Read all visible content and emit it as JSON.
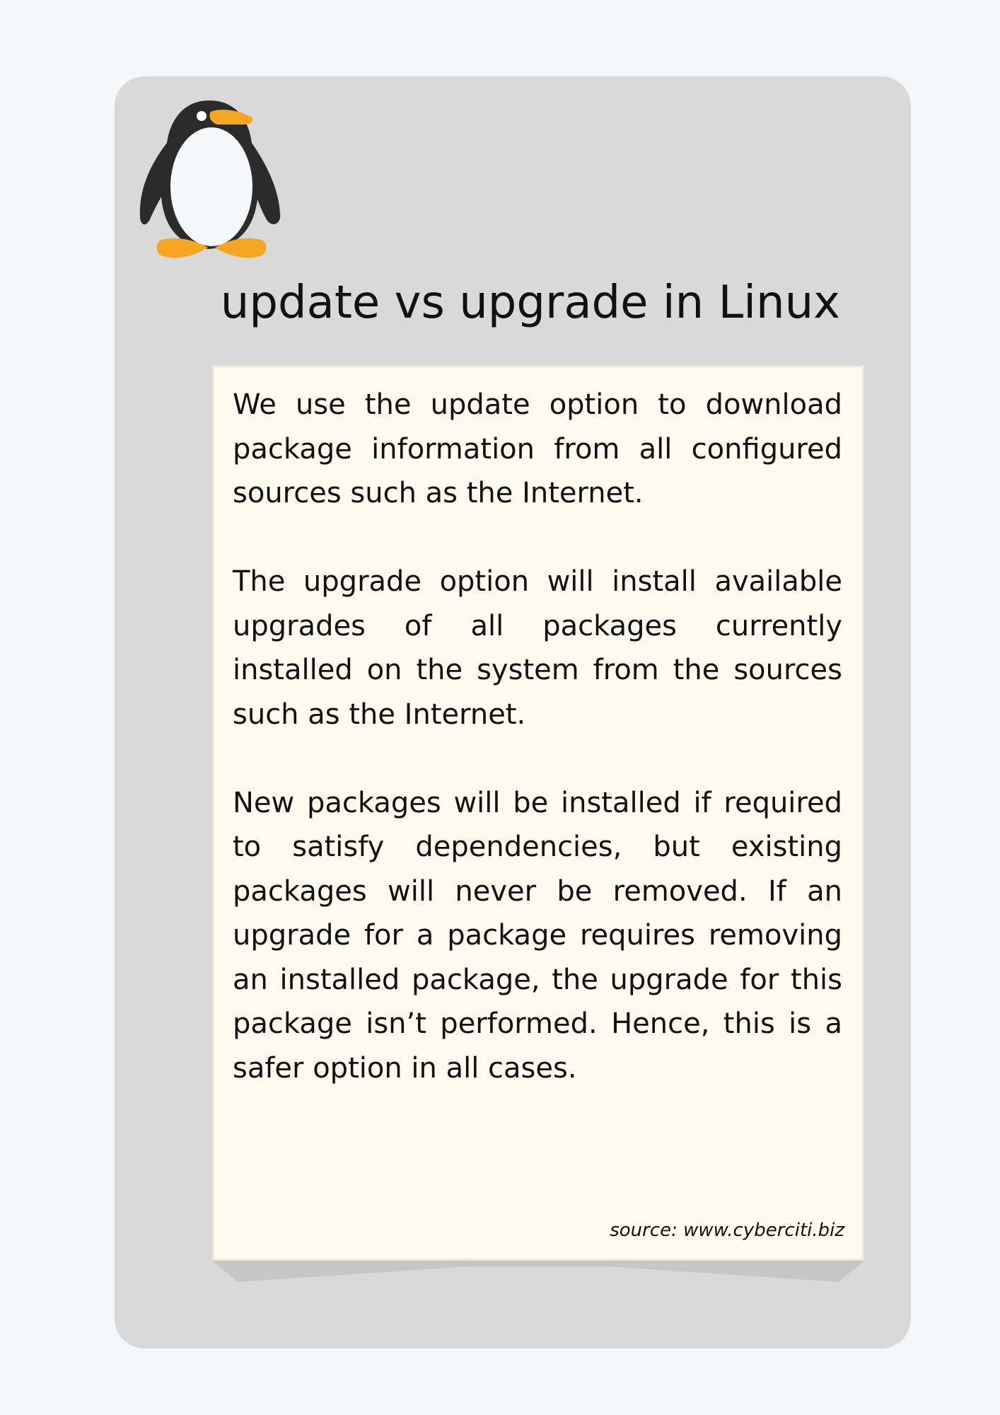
{
  "title": "update vs upgrade in Linux",
  "paragraphs": [
    "We use the update option to download package information from all configured sources such as the Internet.",
    "The upgrade option will install available upgrades of all packages currently installed on the system from the sources such as the Internet.",
    "New packages will be installed if required to satisfy dependencies, but existing packages will never be removed. If an upgrade for a package requires removing an installed package, the upgrade for this package isn’t performed. Hence, this is a safer option in all cases."
  ],
  "source": "source: www.cyberciti.biz",
  "icons": {
    "logo": "penguin-icon"
  },
  "colors": {
    "page_background": "#f3f7fa",
    "card_background": "#d9d9d9",
    "paper_background": "#fdfaf0",
    "penguin_body": "#2b2b2b",
    "penguin_belly": "#f5f8fb",
    "penguin_beak_feet": "#f5a623"
  }
}
